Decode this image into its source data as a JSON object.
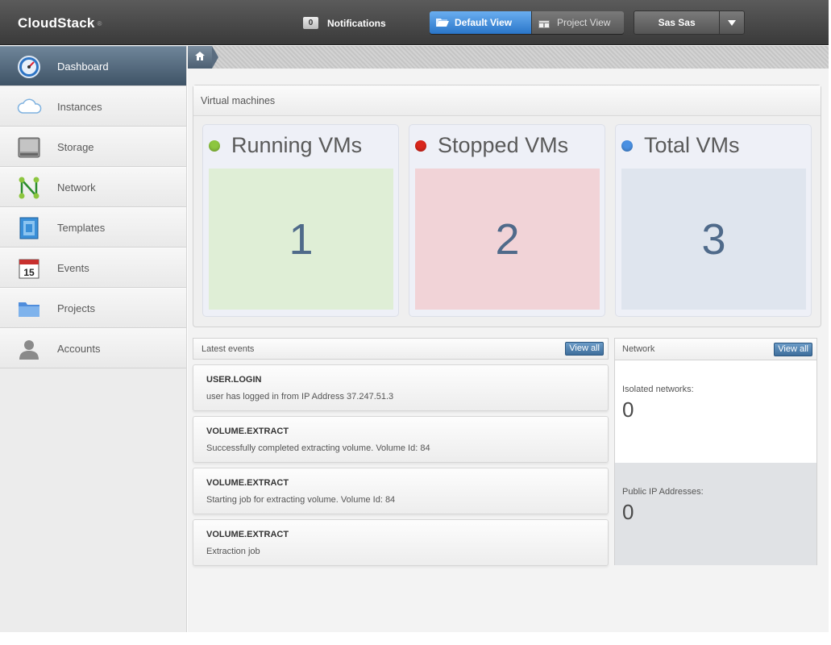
{
  "header": {
    "logo": "CloudStack",
    "logo_mark": "®",
    "notifications_count": "0",
    "notifications_label": "Notifications",
    "default_view_label": "Default View",
    "project_view_label": "Project View",
    "user_name": "Sas Sas"
  },
  "sidebar": {
    "items": [
      {
        "label": "Dashboard",
        "icon": "dashboard-icon"
      },
      {
        "label": "Instances",
        "icon": "cloud-icon"
      },
      {
        "label": "Storage",
        "icon": "disk-icon"
      },
      {
        "label": "Network",
        "icon": "network-icon"
      },
      {
        "label": "Templates",
        "icon": "template-icon"
      },
      {
        "label": "Events",
        "icon": "calendar-icon"
      },
      {
        "label": "Projects",
        "icon": "folder-icon"
      },
      {
        "label": "Accounts",
        "icon": "user-icon"
      }
    ]
  },
  "breadcrumb": {
    "home_icon": "home-icon"
  },
  "vm_panel": {
    "title": "Virtual machines",
    "cards": [
      {
        "label": "Running VMs",
        "value": "1",
        "dot_color": "#8dc63f",
        "box_color": "#dfeed6"
      },
      {
        "label": "Stopped VMs",
        "value": "2",
        "dot_color": "#d9261c",
        "box_color": "#f1d3d7"
      },
      {
        "label": "Total VMs",
        "value": "3",
        "dot_color": "#4a90e2",
        "box_color": "#dfe5ee"
      }
    ]
  },
  "events": {
    "title": "Latest events",
    "view_all": "View all",
    "items": [
      {
        "title": "USER.LOGIN",
        "description": "user has logged in from IP Address 37.247.51.3"
      },
      {
        "title": "VOLUME.EXTRACT",
        "description": "Successfully completed extracting volume. Volume Id: 84"
      },
      {
        "title": "VOLUME.EXTRACT",
        "description": "Starting job for extracting volume. Volume Id: 84"
      },
      {
        "title": "VOLUME.EXTRACT",
        "description": "Extraction job"
      }
    ]
  },
  "network": {
    "title": "Network",
    "view_all": "View all",
    "isolated_label": "Isolated networks:",
    "isolated_value": "0",
    "public_ip_label": "Public IP Addresses:",
    "public_ip_value": "0"
  }
}
